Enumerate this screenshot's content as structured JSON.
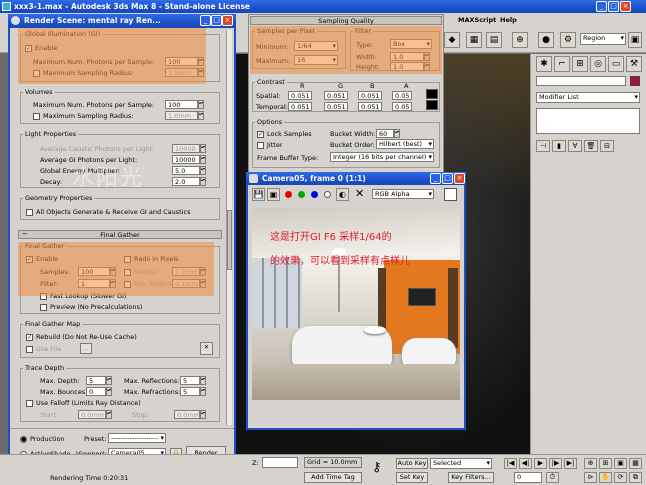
{
  "main_title": "xxx3-1.max - Autodesk 3ds Max 8 - Stand-alone License",
  "menu": {
    "maxscript": "MAXScript",
    "help": "Help"
  },
  "toolbar": {
    "region": "Region"
  },
  "render_scene": {
    "title": "Render Scene: mental ray Ren...",
    "gi": {
      "legend": "Global Illumination (GI)",
      "enable": "Enable",
      "max_photons_label": "Maximum Num. Photons per Sample:",
      "max_photons": "100",
      "max_radius_label": "Maximum Sampling Radius:",
      "max_radius": "1.0mm"
    },
    "volumes": {
      "legend": "Volumes",
      "max_photons_label": "Maximum Num. Photons per Sample:",
      "max_photons": "100",
      "max_radius_label": "Maximum Sampling Radius:",
      "max_radius": "1.0mm"
    },
    "light_props": {
      "legend": "Light Properties",
      "caustic_label": "Average Caustic Photons per Light:",
      "caustic": "10000",
      "gi_label": "Average GI Photons per Light:",
      "gi": "10000",
      "energy_label": "Global Energy Multiplier:",
      "energy": "5.0",
      "decay_label": "Decay:",
      "decay": "2.0"
    },
    "geometry": {
      "legend": "Geometry Properties",
      "all_objects": "All Objects Generate & Receive GI and Caustics"
    },
    "final_gather_header": "Final Gather",
    "final_gather": {
      "legend": "Final Gather",
      "enable": "Enable",
      "samples_label": "Samples:",
      "samples": "100",
      "filter_label": "Filter:",
      "filter": "1",
      "radii": "Radii in Pixels",
      "radius_label": "Radius:",
      "radius": "1.0mm",
      "min_radius_label": "Min. Radius:",
      "min_radius": "0.1mm",
      "fast_lookup": "Fast Lookup (Slower GI)",
      "preview": "Preview (No Precalculations)"
    },
    "fg_map": {
      "legend": "Final Gather Map",
      "rebuild": "Rebuild (Do Not Re-Use Cache)",
      "use_file": "Use File",
      "browse": "..."
    },
    "trace_depth": {
      "legend": "Trace Depth",
      "max_depth_label": "Max. Depth:",
      "max_depth": "5",
      "max_reflections_label": "Max. Reflections:",
      "max_reflections": "5",
      "max_bounces_label": "Max. Bounces:",
      "max_bounces": "0",
      "max_refractions_label": "Max. Refractions:",
      "max_refractions": "5",
      "use_falloff": "Use Falloff (Limits Ray Distance)",
      "start_label": "Start:",
      "start": "0.0mm",
      "stop_label": "Stop:",
      "stop": "0.0mm"
    },
    "production": "Production",
    "activeshade": "ActiveShade",
    "preset_label": "Preset:",
    "preset": "--------------------",
    "viewport_label": "Viewport:",
    "viewport": "Camera05",
    "render_button": "Render"
  },
  "sampling": {
    "title": "Sampling Quality",
    "spp_legend": "Samples per Pixel",
    "minimum_label": "Minimum:",
    "minimum": "1/64",
    "maximum_label": "Maximum:",
    "maximum": "16",
    "filter_legend": "Filter",
    "type_label": "Type:",
    "type": "Box",
    "width_label": "Width:",
    "width": "1.0",
    "height_label": "Height:",
    "height": "1.0",
    "contrast_legend": "Contrast",
    "channels": [
      "R",
      "G",
      "B",
      "A"
    ],
    "spatial_label": "Spatial:",
    "spatial": [
      "0.051",
      "0.051",
      "0.051",
      "0.05"
    ],
    "temporal_label": "Temporal:",
    "temporal": [
      "0.051",
      "0.051",
      "0.051",
      "0.05"
    ],
    "options_legend": "Options",
    "lock_samples": "Lock Samples",
    "jitter": "Jitter",
    "bucket_width_label": "Bucket Width:",
    "bucket_width": "60",
    "bucket_order_label": "Bucket Order:",
    "bucket_order": "Hilbert (best)",
    "fb_type_label": "Frame Buffer Type:",
    "fb_type": "Integer (16 bits per channel)"
  },
  "camera_window": {
    "title": "Camera05, frame 0 (1:1)",
    "channel": "RGB Alpha",
    "overlay_line1": "这是打开GI F6 采样1/64的",
    "overlay_line2": "的效果，可以看到采样有点样儿"
  },
  "watermark": "水阳光",
  "command_panel": {
    "modifier_list": "Modifier List"
  },
  "status": {
    "rendering_time": "Rendering Time 0:20:31",
    "z_label": "Z:",
    "grid": "Grid = 10.0mm",
    "add_time_tag": "Add Time Tag",
    "auto_key": "Auto Key",
    "selected": "Selected",
    "set_key": "Set Key",
    "key_filters": "Key Filters...",
    "frame": "0"
  },
  "colors": {
    "title_bar": "#1d4fc7",
    "highlight": "#f08c3c",
    "panel": "#d6d3ce",
    "swatch": "#a0143c"
  }
}
